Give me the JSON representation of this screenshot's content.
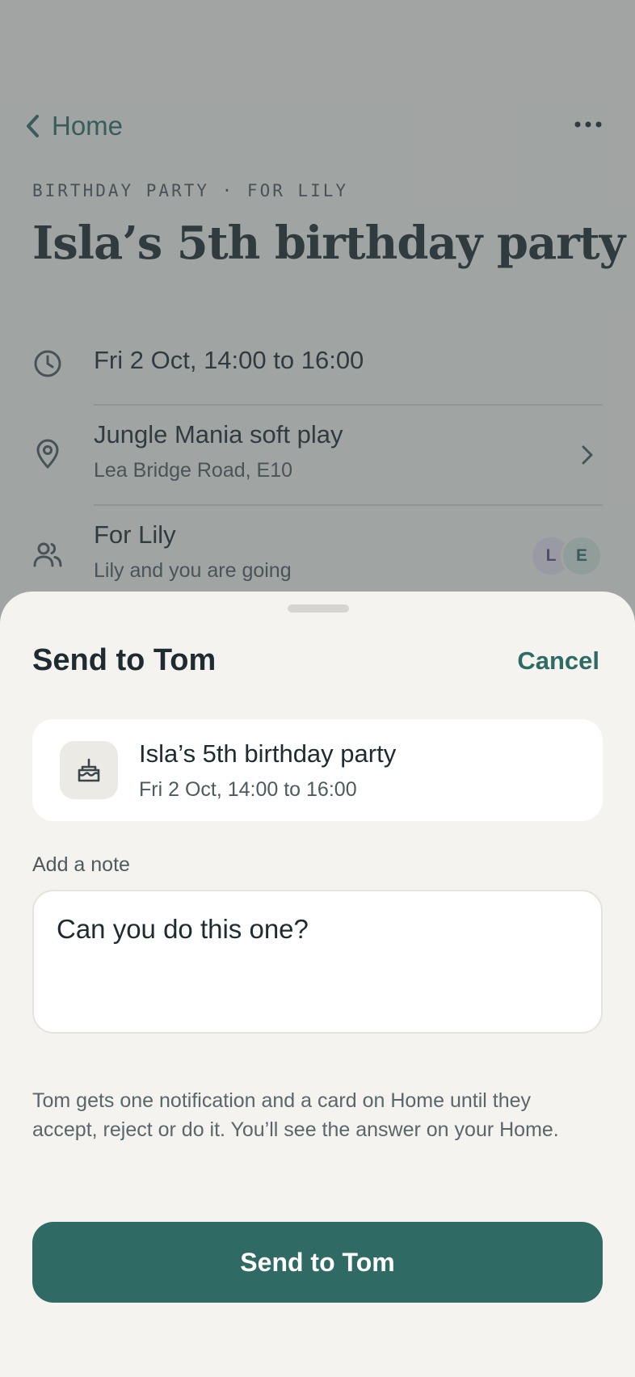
{
  "nav": {
    "back_label": "Home",
    "more_icon": "more-horizontal-icon"
  },
  "event": {
    "eyebrow": "BIRTHDAY PARTY · FOR LILY",
    "title": "Isla’s 5th birthday party",
    "time": "Fri 2 Oct, 14:00 to 16:00",
    "location": {
      "name": "Jungle Mania soft play",
      "address": "Lea Bridge Road, E10"
    },
    "people": {
      "for": "For Lily",
      "going": "Lily and you are going",
      "avatars": [
        "L",
        "E"
      ]
    }
  },
  "sheet": {
    "title": "Send to Tom",
    "cancel_label": "Cancel",
    "card": {
      "title": "Isla’s 5th birthday party",
      "subtitle": "Fri 2 Oct, 14:00 to 16:00",
      "icon": "cake-icon"
    },
    "note_label": "Add a note",
    "note_value": "Can you do this one?",
    "info": "Tom gets one notification and a card on Home until they accept, reject or do it. You’ll see the answer on your Home.",
    "send_label": "Send to Tom"
  },
  "colors": {
    "accent": "#2f6b64",
    "background": "#f4f3ef",
    "text": "#1e2b30"
  }
}
